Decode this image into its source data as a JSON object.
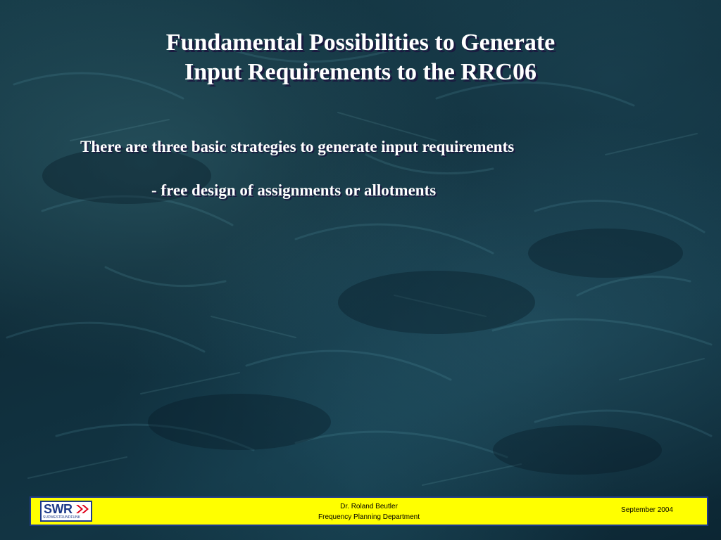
{
  "slide": {
    "title_line1": "Fundamental Possibilities to Generate",
    "title_line2": "Input Requirements to the RRC06",
    "intro": "There are three basic strategies to generate input requirements",
    "bullet": "- free design of assignments or allotments"
  },
  "footer": {
    "logo_text": "SWR",
    "logo_subtext": "SÜDWESTRUNDFUNK",
    "author": "Dr. Roland Beutler",
    "department": "Frequency Planning Department",
    "date": "September 2004"
  },
  "colors": {
    "background": "#123544",
    "title_text": "#ffffff",
    "text_shadow": "#1a1a40",
    "footer_bar": "#ffff00",
    "footer_border": "#1e3a8a",
    "logo_blue": "#1e3a8a",
    "logo_arrow": "#e0001a"
  }
}
